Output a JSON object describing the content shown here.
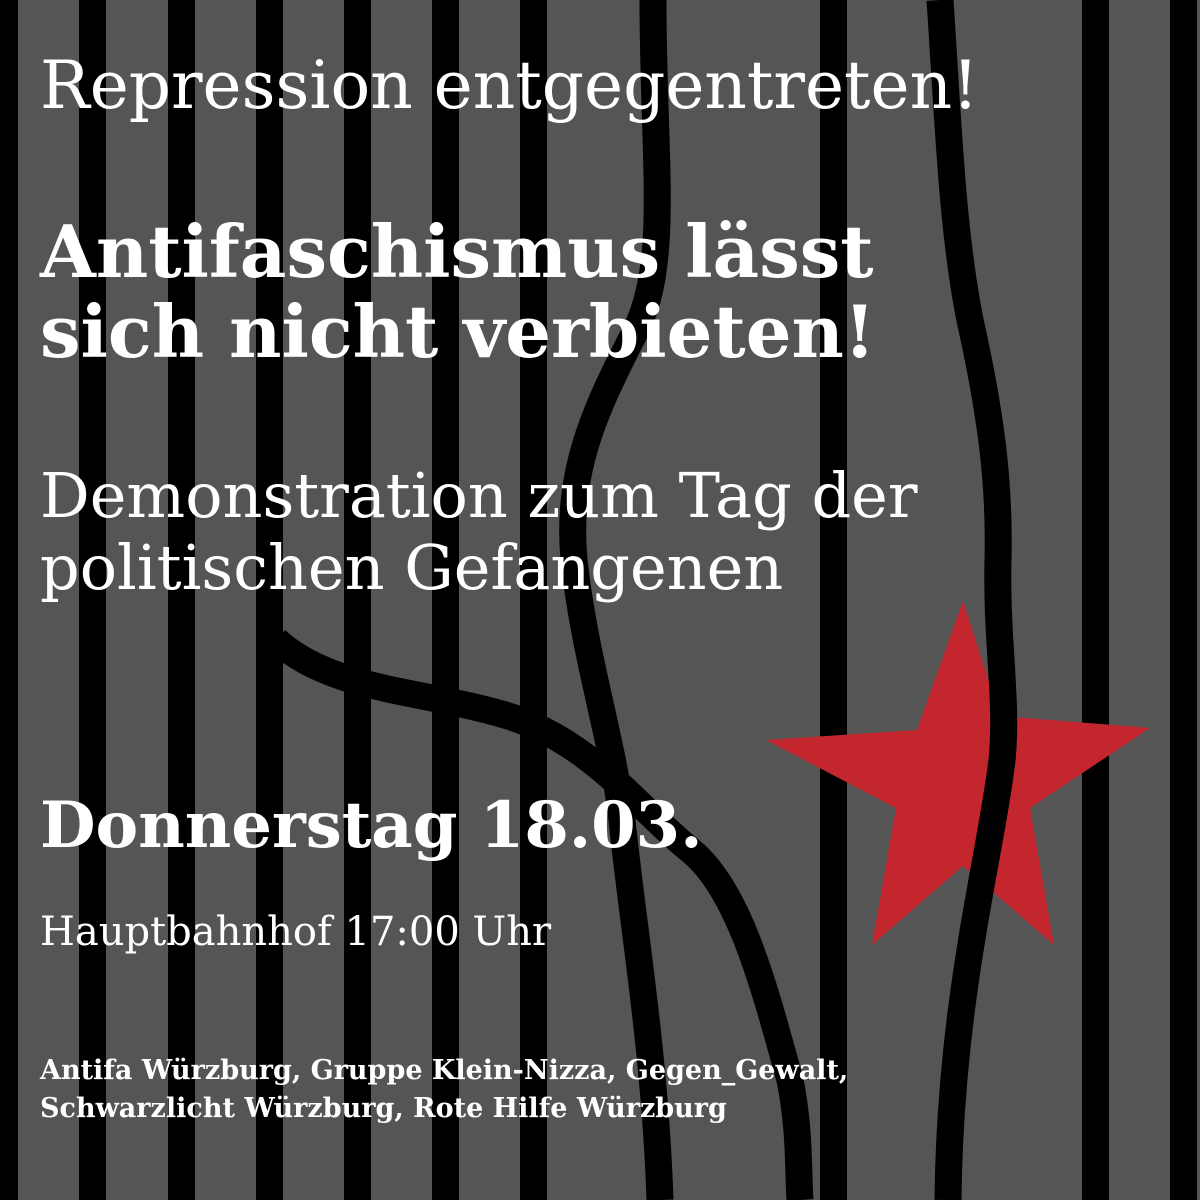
{
  "poster": {
    "kicker": "Repression entgegentreten!",
    "headline_lines": [
      "Antifaschismus lässt",
      "sich nicht verbieten!"
    ],
    "subhead_lines": [
      "Demonstration zum Tag der",
      "politischen Gefangenen"
    ],
    "date": "Donnerstag 18.03.",
    "place_time": "Hauptbahnhof 17:00 Uhr",
    "organizer_lines": [
      "Antifa Würzburg, Gruppe Klein-Nizza, Gegen_Gewalt,",
      "Schwarzlicht Würzburg, Rote Hilfe Würzburg"
    ]
  },
  "colors": {
    "background": "#555555",
    "bars": "#000000",
    "star": "#c4262e",
    "text": "#ffffff"
  },
  "decoration": {
    "bars": "prison-bars-vertical",
    "star": "red-five-point-star"
  }
}
